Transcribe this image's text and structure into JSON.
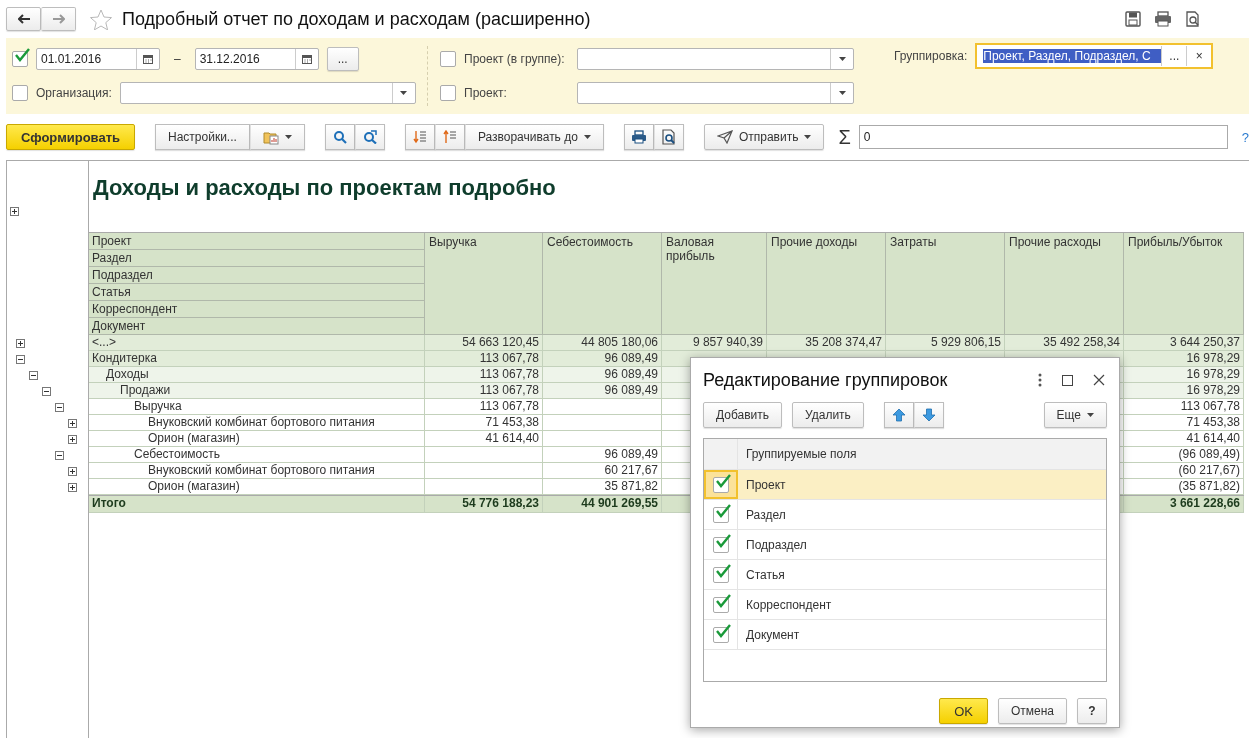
{
  "window": {
    "title": "Подробный отчет по доходам и расходам (расширенно)",
    "favorite": false
  },
  "filters": {
    "period": {
      "enabled": true,
      "from": "01.01.2016",
      "dash": "–",
      "to": "31.12.2016",
      "more": "..."
    },
    "organization": {
      "enabled": false,
      "label": "Организация:"
    },
    "project_group": {
      "enabled": false,
      "label": "Проект (в группе):"
    },
    "project": {
      "enabled": false,
      "label": "Проект:"
    },
    "grouping": {
      "label": "Группировка:",
      "value": "Проект, Раздел, Подраздел, С",
      "more": "...",
      "clear": "×"
    }
  },
  "toolbar": {
    "generate": "Сформировать",
    "settings": "Настройки...",
    "expand_to": "Разворачивать до",
    "send": "Отправить",
    "sum_sign": "Σ",
    "sum_value": "0",
    "help": "?"
  },
  "report": {
    "title": "Доходы и расходы по проектам подробно",
    "header_expanded": false,
    "grouping_headers": [
      "Проект",
      "Раздел",
      "Подраздел",
      "Статья",
      "Корреспондент",
      "Документ"
    ],
    "columns": {
      "revenue": "Выручка",
      "cost": "Себестоимость",
      "gross_profit": "Валовая прибыль",
      "other_income": "Прочие доходы",
      "expenses": "Затраты",
      "other_expenses": "Прочие расходы",
      "profit": "Прибыль/Убыток"
    },
    "rows": [
      {
        "label": "<...>",
        "expanded": false,
        "values": {
          "revenue": "54 663 120,45",
          "cost": "44 805 180,06",
          "gross_profit": "9 857 940,39",
          "other_income": "35 208 374,47",
          "expenses": "5 929 806,15",
          "other_expenses": "35 492 258,34",
          "profit": "3 644 250,37"
        }
      },
      {
        "label": "Кондитерка",
        "expanded": true,
        "values": {
          "revenue": "113 067,78",
          "cost": "96 089,49",
          "profit": "16 978,29"
        },
        "children": [
          {
            "label": "Доходы",
            "expanded": true,
            "values": {
              "revenue": "113 067,78",
              "cost": "96 089,49",
              "profit": "16 978,29"
            },
            "children": [
              {
                "label": "Продажи",
                "expanded": true,
                "values": {
                  "revenue": "113 067,78",
                  "cost": "96 089,49",
                  "profit": "16 978,29"
                },
                "children": [
                  {
                    "label": "Выручка",
                    "expanded": true,
                    "values": {
                      "revenue": "113 067,78",
                      "profit": "113 067,78"
                    },
                    "children": [
                      {
                        "label": "Внуковский комбинат бортового питания",
                        "expanded": false,
                        "values": {
                          "revenue": "71 453,38",
                          "profit": "71 453,38"
                        }
                      },
                      {
                        "label": "Орион (магазин)",
                        "expanded": false,
                        "values": {
                          "revenue": "41 614,40",
                          "profit": "41 614,40"
                        }
                      }
                    ]
                  },
                  {
                    "label": "Себестоимость",
                    "expanded": true,
                    "values": {
                      "cost": "96 089,49",
                      "profit": "(96 089,49)"
                    },
                    "children": [
                      {
                        "label": "Внуковский комбинат бортового питания",
                        "expanded": false,
                        "values": {
                          "cost": "60 217,67",
                          "profit": "(60 217,67)"
                        }
                      },
                      {
                        "label": "Орион (магазин)",
                        "expanded": false,
                        "values": {
                          "cost": "35 871,82",
                          "profit": "(35 871,82)"
                        }
                      }
                    ]
                  }
                ]
              }
            ]
          }
        ]
      }
    ],
    "total": {
      "label": "Итого",
      "values": {
        "revenue": "54 776 188,23",
        "cost": "44 901 269,55",
        "profit": "3 661 228,66"
      }
    }
  },
  "dialog": {
    "title": "Редактирование группировок",
    "add": "Добавить",
    "remove": "Удалить",
    "more": "Еще",
    "column": "Группируемые поля",
    "fields": [
      {
        "name": "Проект",
        "checked": true,
        "selected": true
      },
      {
        "name": "Раздел",
        "checked": true,
        "selected": false
      },
      {
        "name": "Подраздел",
        "checked": true,
        "selected": false
      },
      {
        "name": "Статья",
        "checked": true,
        "selected": false
      },
      {
        "name": "Корреспондент",
        "checked": true,
        "selected": false
      },
      {
        "name": "Документ",
        "checked": true,
        "selected": false
      }
    ],
    "ok": "OK",
    "cancel": "Отмена",
    "help": "?"
  }
}
